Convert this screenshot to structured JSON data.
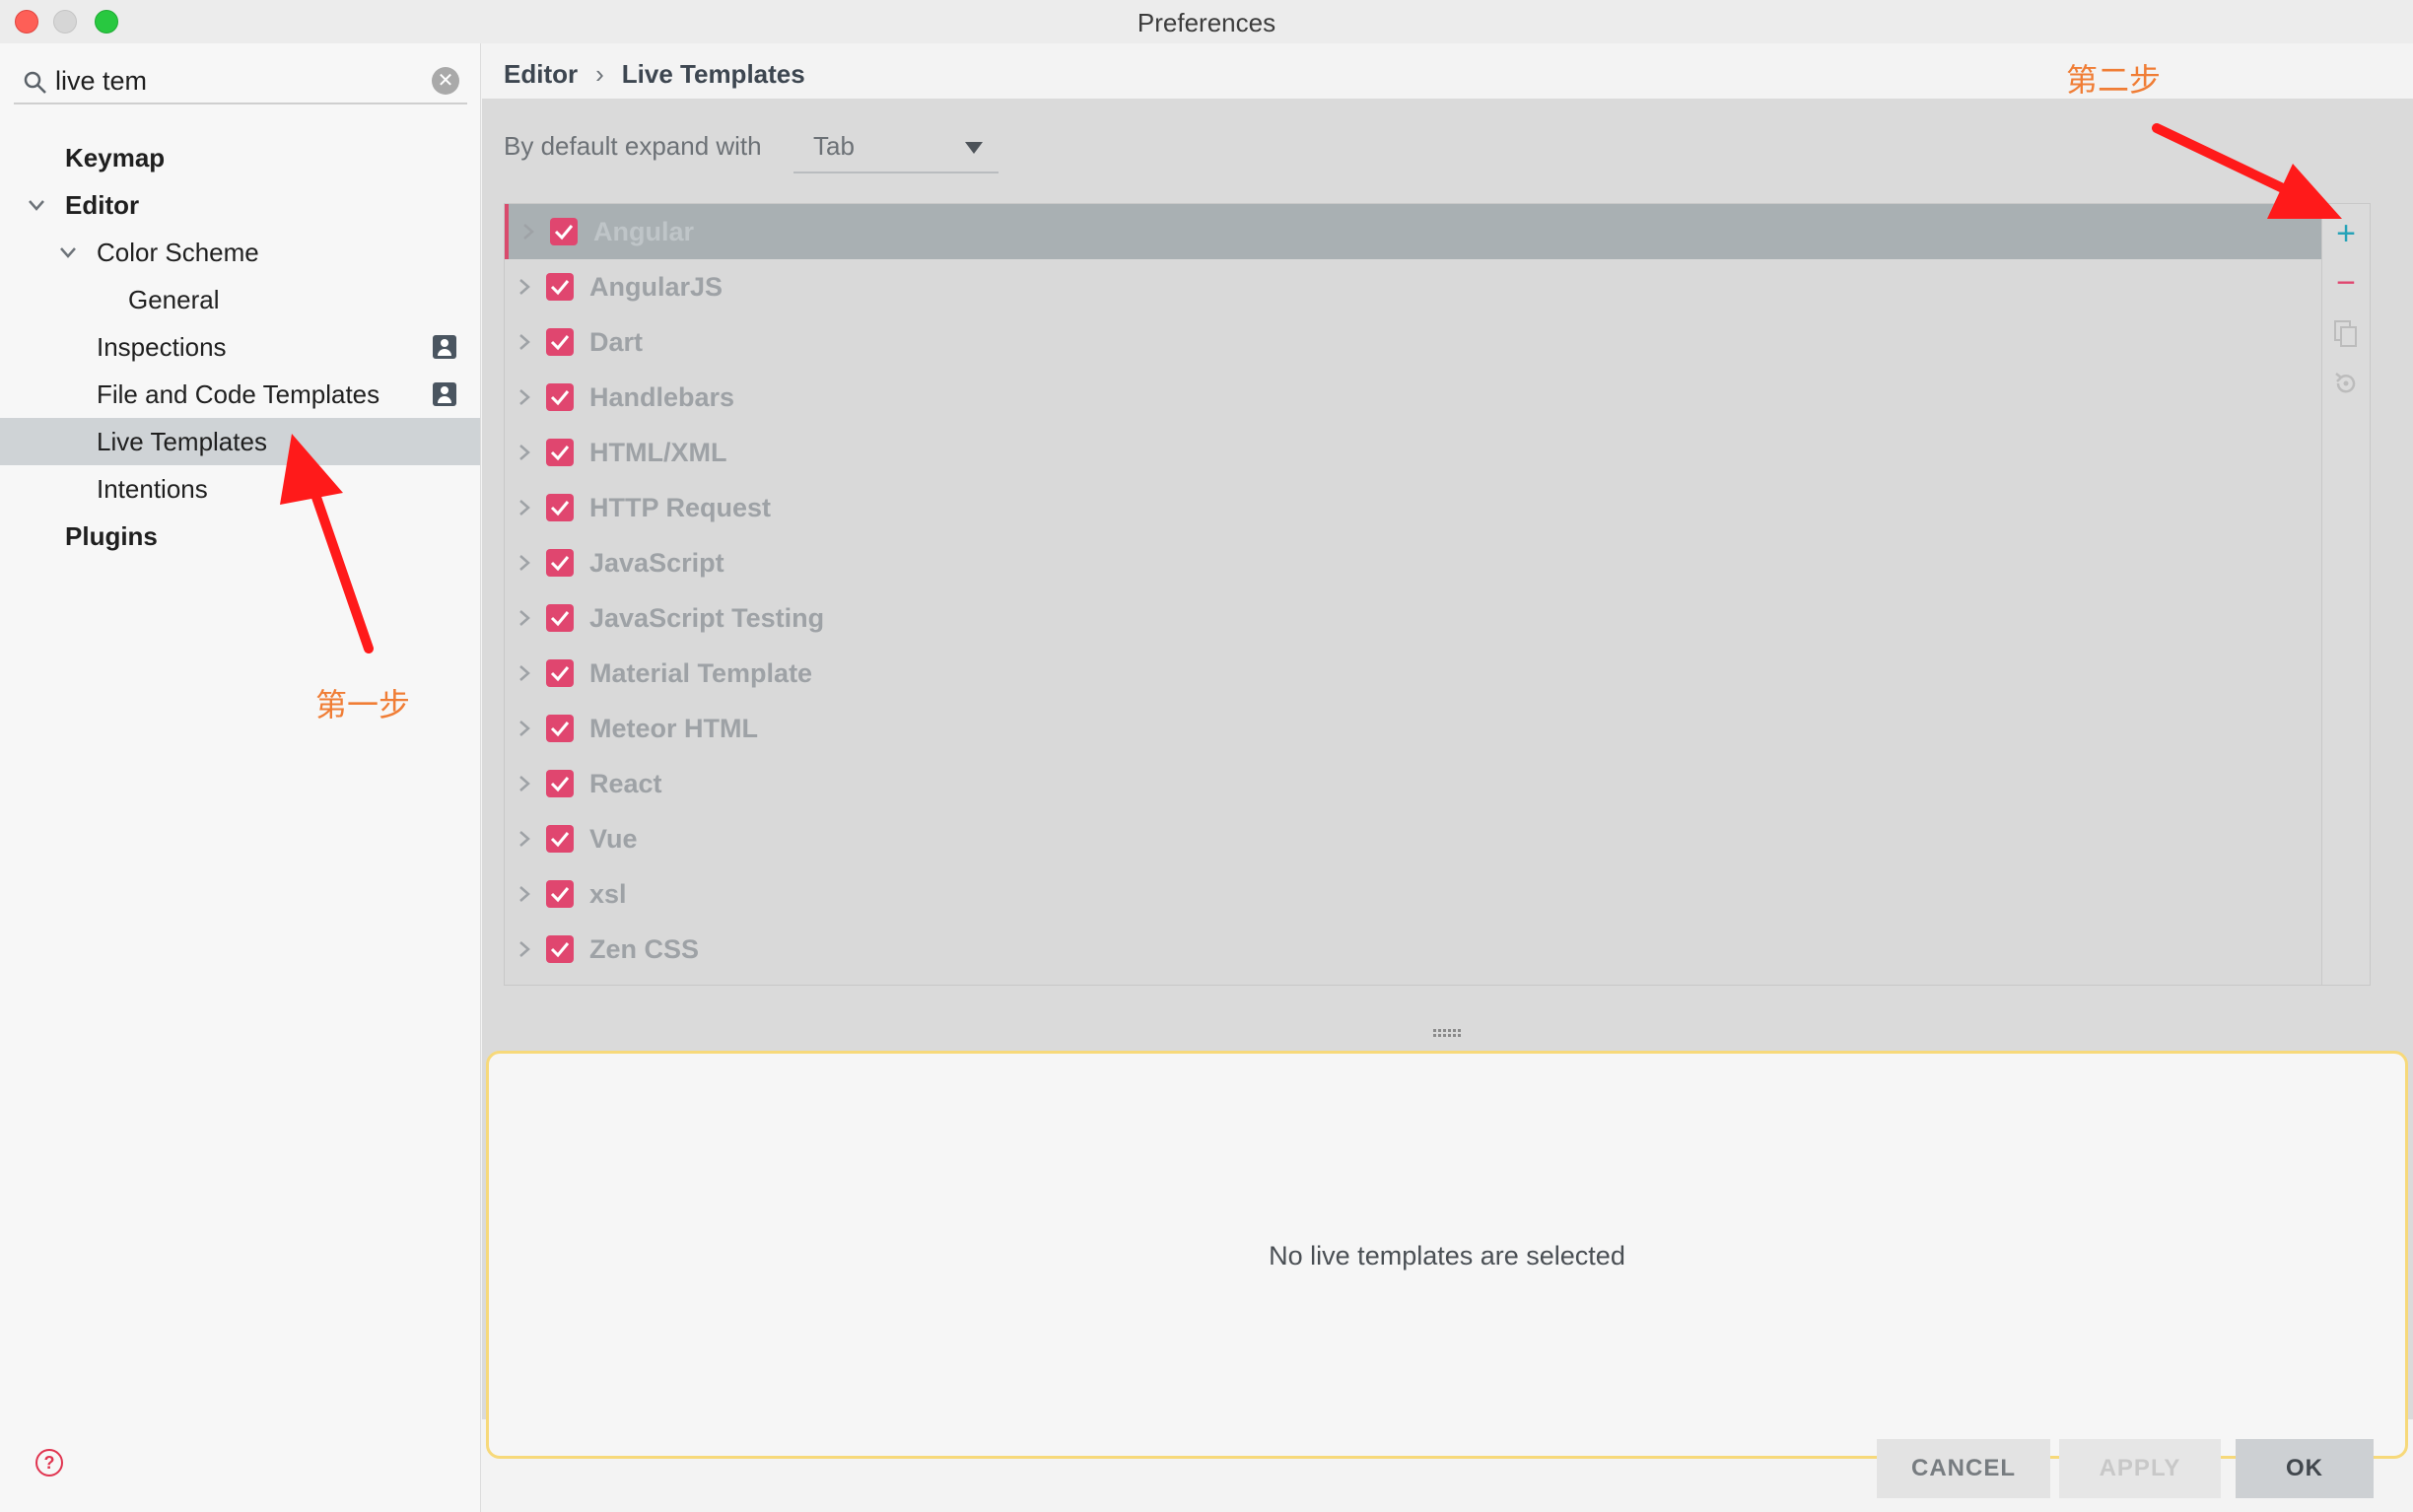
{
  "window": {
    "title": "Preferences"
  },
  "search": {
    "value": "live tem",
    "placeholder": ""
  },
  "sidebar": {
    "items": [
      {
        "label": "Keymap"
      },
      {
        "label": "Editor"
      },
      {
        "label": "Color Scheme"
      },
      {
        "label": "General"
      },
      {
        "label": "Inspections"
      },
      {
        "label": "File and Code Templates"
      },
      {
        "label": "Live Templates"
      },
      {
        "label": "Intentions"
      },
      {
        "label": "Plugins"
      }
    ]
  },
  "breadcrumb": {
    "parent": "Editor",
    "separator": "›",
    "current": "Live Templates"
  },
  "expand": {
    "label": "By default expand with",
    "value": "Tab"
  },
  "templates": [
    {
      "label": "Angular"
    },
    {
      "label": "AngularJS"
    },
    {
      "label": "Dart"
    },
    {
      "label": "Handlebars"
    },
    {
      "label": "HTML/XML"
    },
    {
      "label": "HTTP Request"
    },
    {
      "label": "JavaScript"
    },
    {
      "label": "JavaScript Testing"
    },
    {
      "label": "Material Template"
    },
    {
      "label": "Meteor HTML"
    },
    {
      "label": "React"
    },
    {
      "label": "Vue"
    },
    {
      "label": "xsl"
    },
    {
      "label": "Zen CSS"
    }
  ],
  "tools": {
    "add": "+",
    "remove": "−"
  },
  "detail": {
    "message": "No live templates are selected"
  },
  "buttons": {
    "cancel": "CANCEL",
    "apply": "APPLY",
    "ok": "OK"
  },
  "annotations": {
    "step1": "第一步",
    "step2": "第二步"
  },
  "colors": {
    "accent": "#e0466f",
    "selected_row": "#cfd3d6",
    "annotation": "#f07d35",
    "arrow": "#ff1a1a"
  },
  "icons": [
    "search-icon",
    "clear-icon",
    "chevron-down-icon",
    "chevron-right-icon",
    "profile-icon",
    "checkbox-icon",
    "add-icon",
    "remove-icon",
    "copy-icon",
    "restore-icon",
    "help-icon"
  ]
}
